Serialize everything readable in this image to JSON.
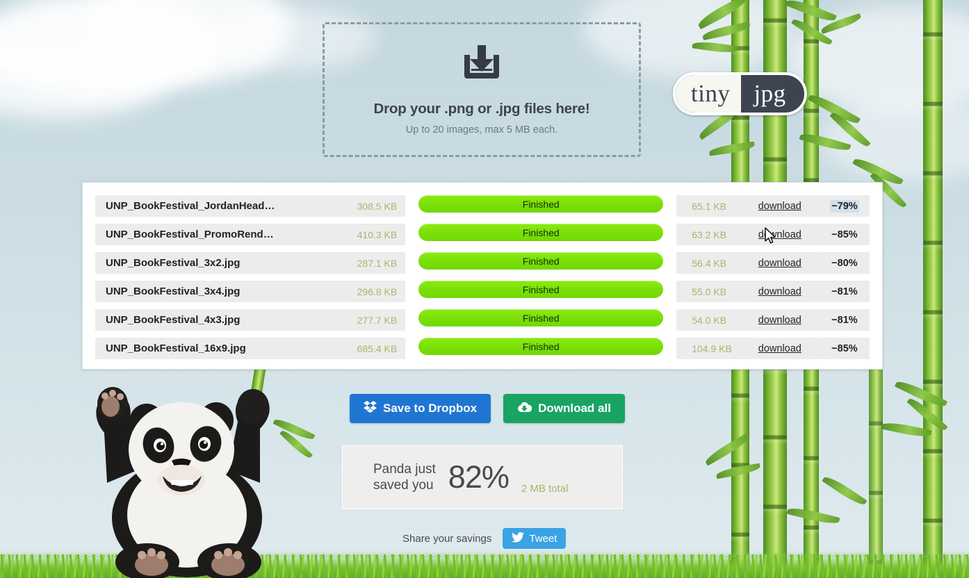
{
  "site": {
    "logo_left": "tiny",
    "logo_right": "jpg"
  },
  "dropzone": {
    "icon": "download-tray-icon",
    "title": "Drop your .png or .jpg files here!",
    "subtitle": "Up to 20 images, max 5 MB each."
  },
  "results": {
    "status_label": "Finished",
    "download_label": "download",
    "rows": [
      {
        "name": "UNP_BookFestival_JordanHead…",
        "original": "308.5 KB",
        "status": "Finished",
        "compressed": "65.1 KB",
        "download": "download",
        "percent": "−79%",
        "selected": true
      },
      {
        "name": "UNP_BookFestival_PromoRend…",
        "original": "410.3 KB",
        "status": "Finished",
        "compressed": "63.2 KB",
        "download": "download",
        "percent": "−85%",
        "selected": false
      },
      {
        "name": "UNP_BookFestival_3x2.jpg",
        "original": "287.1 KB",
        "status": "Finished",
        "compressed": "56.4 KB",
        "download": "download",
        "percent": "−80%",
        "selected": false
      },
      {
        "name": "UNP_BookFestival_3x4.jpg",
        "original": "296.8 KB",
        "status": "Finished",
        "compressed": "55.0 KB",
        "download": "download",
        "percent": "−81%",
        "selected": false
      },
      {
        "name": "UNP_BookFestival_4x3.jpg",
        "original": "277.7 KB",
        "status": "Finished",
        "compressed": "54.0 KB",
        "download": "download",
        "percent": "−81%",
        "selected": false
      },
      {
        "name": "UNP_BookFestival_16x9.jpg",
        "original": "685.4 KB",
        "status": "Finished",
        "compressed": "104.9 KB",
        "download": "download",
        "percent": "−85%",
        "selected": false
      }
    ]
  },
  "actions": {
    "dropbox_label": "Save to Dropbox",
    "dropbox_icon": "dropbox-icon",
    "download_all_label": "Download all",
    "download_all_icon": "cloud-download-icon"
  },
  "savings": {
    "line1": "Panda just",
    "line2": "saved you",
    "percent": "82%",
    "total": "2 MB total"
  },
  "share": {
    "label": "Share your savings",
    "tweet_label": "Tweet",
    "tweet_icon": "twitter-bird-icon"
  },
  "colors": {
    "progress_green": "#79df06",
    "size_green": "#9fba6c",
    "dropbox_blue": "#1f76d2",
    "download_green": "#19a463",
    "tweet_blue": "#3aa3e3",
    "logo_dark": "#3d4450",
    "selection_blue": "#cfe0ee",
    "sky": "#cbdde3"
  }
}
